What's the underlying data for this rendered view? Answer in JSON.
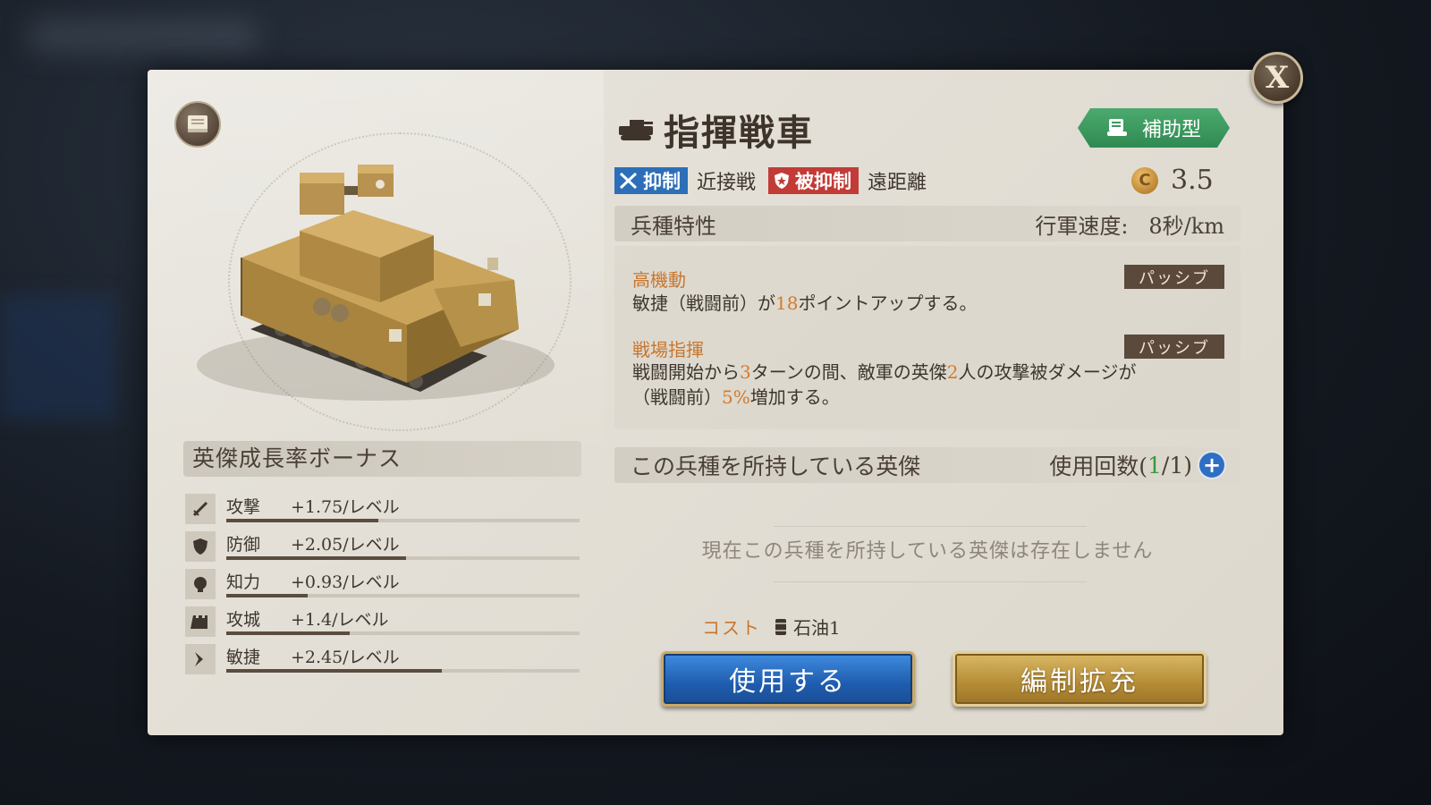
{
  "dialog": {
    "close_label": "X",
    "unit_name": "指揮戦車",
    "type_badge": "補助型",
    "tags": {
      "counter_label": "抑制",
      "counter_target": "近接戦",
      "countered_label": "被抑制",
      "countered_by": "遠距離"
    },
    "cost_rating": "3.5",
    "cost_coin_letter": "C"
  },
  "traits": {
    "header": "兵種特性",
    "march_speed_label": "行軍速度:",
    "march_speed_value": "8秒/km",
    "items": [
      {
        "name": "高機動",
        "type": "パッシブ",
        "desc_parts": [
          "敏捷（戦闘前）が",
          "18",
          "ポイントアップする。"
        ]
      },
      {
        "name": "戦場指揮",
        "type": "パッシブ",
        "desc_parts": [
          "戦闘開始から",
          "3",
          "ターンの間、敵軍の英傑",
          "2",
          "人の攻撃被ダメージが",
          "（戦闘前）",
          "5%",
          "増加する。"
        ]
      }
    ]
  },
  "growth": {
    "header": "英傑成長率ボーナス",
    "stats": [
      {
        "label": "攻撃",
        "value": "+1.75/レベル",
        "icon": "sword-icon",
        "fill": 0.43
      },
      {
        "label": "防御",
        "value": "+2.05/レベル",
        "icon": "shield-icon",
        "fill": 0.51
      },
      {
        "label": "知力",
        "value": "+0.93/レベル",
        "icon": "head-icon",
        "fill": 0.23
      },
      {
        "label": "攻城",
        "value": "+1.4/レベル",
        "icon": "castle-icon",
        "fill": 0.35
      },
      {
        "label": "敏捷",
        "value": "+2.45/レベル",
        "icon": "boot-icon",
        "fill": 0.61
      }
    ]
  },
  "heroes": {
    "header": "この兵種を所持している英傑",
    "usage_prefix": "使用回数(",
    "usage_current": "1",
    "usage_suffix": "/1)",
    "empty_message": "現在この兵種を所持している英傑は存在しません"
  },
  "cost": {
    "label": "コスト",
    "value": "石油1"
  },
  "buttons": {
    "use": "使用する",
    "expand": "編制拡充"
  },
  "colors": {
    "accent_orange": "#d47a2c",
    "use_button": "#1f5cae",
    "expand_button": "#b58c35",
    "badge_green": "#3a9a5e",
    "counter_blue": "#2c6fb8",
    "countered_red": "#c23b36"
  }
}
